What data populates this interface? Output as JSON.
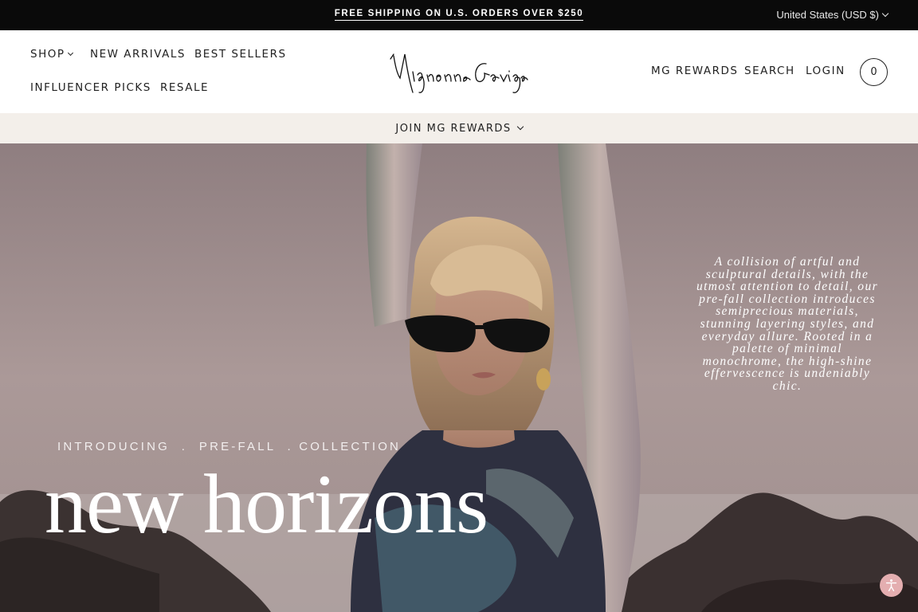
{
  "announcement": {
    "text": "FREE SHIPPING ON U.S. ORDERS OVER $250",
    "currency": "United States (USD $)"
  },
  "nav": {
    "shop": "SHOP",
    "new_arrivals": "NEW ARRIVALS",
    "best_sellers": "BEST SELLERS",
    "influencer_picks": "INFLUENCER PICKS",
    "resale": "RESALE",
    "mg_rewards": "MG REWARDS",
    "search": "SEARCH",
    "login": "LOGIN",
    "cart_count": "0"
  },
  "logo": {
    "text": "Mignonne Gavigan"
  },
  "rewards_bar": {
    "label": "JOIN MG REWARDS"
  },
  "hero": {
    "intro": "INTRODUCING  .  PRE-FALL  . COLLECTION",
    "headline": "new horizons",
    "description": "A collision of artful and sculptural details, with the utmost attention to detail, our pre-fall collection introduces semiprecious materials, stunning layering styles, and everyday allure. Rooted in a palette of minimal monochrome, the high-shine effervescence is undeniably chic."
  },
  "icons": {
    "shop_dropdown": "chevron-down-icon",
    "currency_dropdown": "chevron-down-icon",
    "rewards_dropdown": "chevron-down-icon",
    "accessibility": "accessibility-icon"
  },
  "colors": {
    "announcement_bg": "#0a0a0a",
    "rewards_bg": "#f3efea",
    "accessibility_bg": "#e4aeb0"
  }
}
